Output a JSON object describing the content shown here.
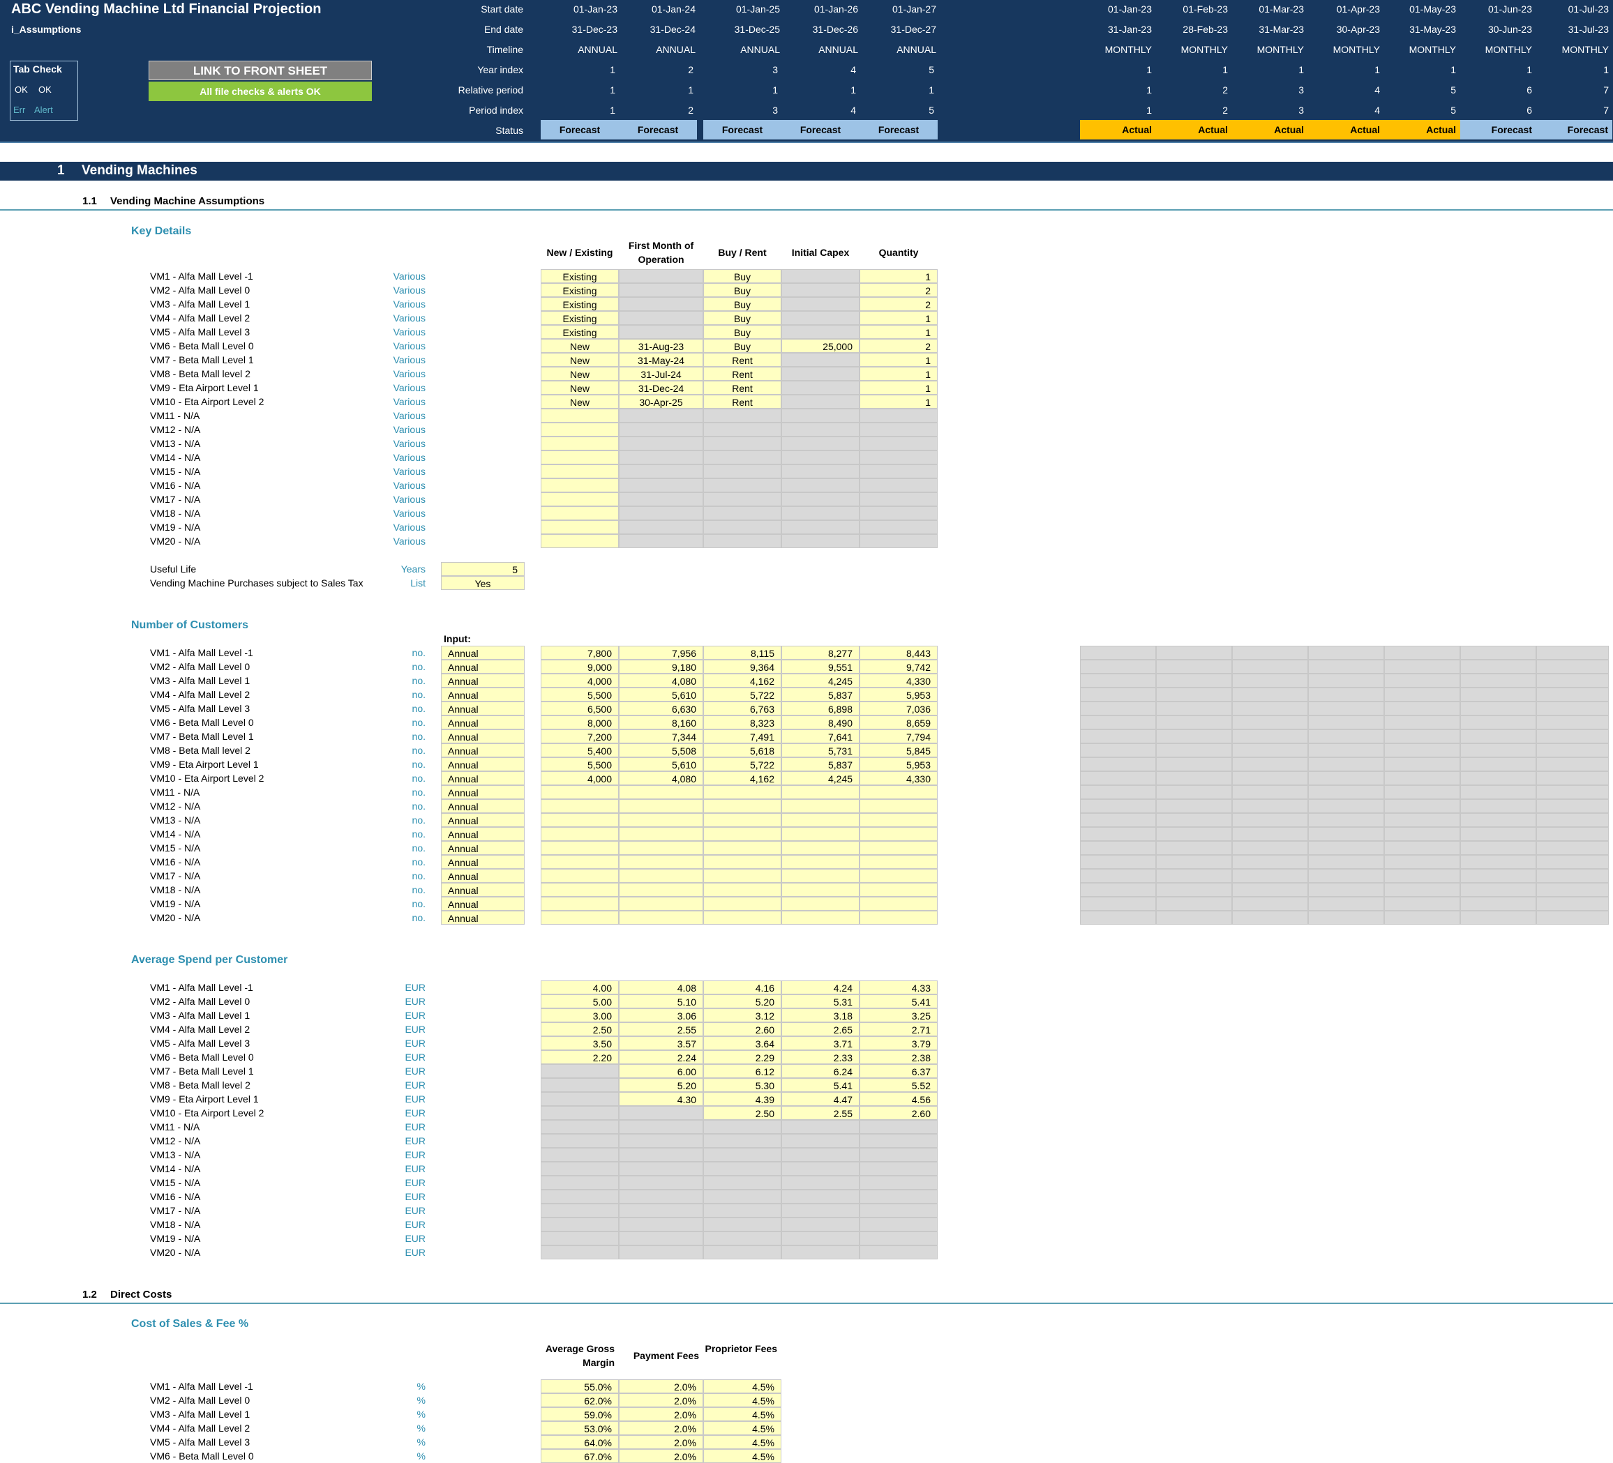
{
  "header": {
    "title": "ABC Vending Machine Ltd Financial Projection",
    "sheet": "i_Assumptions",
    "tabcheck": {
      "label": "Tab Check",
      "ok1": "OK",
      "ok2": "OK",
      "err": "Err",
      "alert": "Alert"
    },
    "link_button": "LINK TO FRONT SHEET",
    "status_button": "All file checks & alerts OK",
    "row_labels": [
      "Start date",
      "End date",
      "Timeline",
      "Year index",
      "Relative period",
      "Period index",
      "Status"
    ],
    "annual": [
      {
        "start": "01-Jan-23",
        "end": "31-Dec-23",
        "timeline": "ANNUAL",
        "year": "1",
        "rel": "1",
        "period": "1",
        "status": "Forecast"
      },
      {
        "start": "01-Jan-24",
        "end": "31-Dec-24",
        "timeline": "ANNUAL",
        "year": "2",
        "rel": "1",
        "period": "2",
        "status": "Forecast"
      },
      {
        "start": "01-Jan-25",
        "end": "31-Dec-25",
        "timeline": "ANNUAL",
        "year": "3",
        "rel": "1",
        "period": "3",
        "status": "Forecast"
      },
      {
        "start": "01-Jan-26",
        "end": "31-Dec-26",
        "timeline": "ANNUAL",
        "year": "4",
        "rel": "1",
        "period": "4",
        "status": "Forecast"
      },
      {
        "start": "01-Jan-27",
        "end": "31-Dec-27",
        "timeline": "ANNUAL",
        "year": "5",
        "rel": "1",
        "period": "5",
        "status": "Forecast"
      }
    ],
    "monthly": [
      {
        "start": "01-Jan-23",
        "end": "31-Jan-23",
        "timeline": "MONTHLY",
        "year": "1",
        "rel": "1",
        "period": "1",
        "status": "Actual"
      },
      {
        "start": "01-Feb-23",
        "end": "28-Feb-23",
        "timeline": "MONTHLY",
        "year": "1",
        "rel": "2",
        "period": "2",
        "status": "Actual"
      },
      {
        "start": "01-Mar-23",
        "end": "31-Mar-23",
        "timeline": "MONTHLY",
        "year": "1",
        "rel": "3",
        "period": "3",
        "status": "Actual"
      },
      {
        "start": "01-Apr-23",
        "end": "30-Apr-23",
        "timeline": "MONTHLY",
        "year": "1",
        "rel": "4",
        "period": "4",
        "status": "Actual"
      },
      {
        "start": "01-May-23",
        "end": "31-May-23",
        "timeline": "MONTHLY",
        "year": "1",
        "rel": "5",
        "period": "5",
        "status": "Actual"
      },
      {
        "start": "01-Jun-23",
        "end": "30-Jun-23",
        "timeline": "MONTHLY",
        "year": "1",
        "rel": "6",
        "period": "6",
        "status": "Forecast"
      },
      {
        "start": "01-Jul-23",
        "end": "31-Jul-23",
        "timeline": "MONTHLY",
        "year": "1",
        "rel": "7",
        "period": "7",
        "status": "Forecast"
      }
    ]
  },
  "colors": {
    "navy": "#17375e",
    "forecast": "#9dc3e6",
    "actual": "#ffc000",
    "input": "#ffffc2",
    "grey": "#d9d9d9",
    "accent": "#2e8fb0",
    "ok_green": "#8dc63f"
  },
  "section1": {
    "num": "1",
    "title": "Vending Machines"
  },
  "s11": {
    "num": "1.1",
    "title": "Vending Machine Assumptions"
  },
  "key_details": {
    "title": "Key Details",
    "headers": [
      "New / Existing",
      "First Month of Operation",
      "Buy / Rent",
      "Initial Capex",
      "Quantity"
    ],
    "rows": [
      {
        "name": "VM1 - Alfa Mall Level -1",
        "unit": "Various",
        "ne": "Existing",
        "fm": "",
        "br": "Buy",
        "capex": "",
        "qty": "1"
      },
      {
        "name": "VM2 - Alfa Mall Level 0",
        "unit": "Various",
        "ne": "Existing",
        "fm": "",
        "br": "Buy",
        "capex": "",
        "qty": "2"
      },
      {
        "name": "VM3 - Alfa Mall Level 1",
        "unit": "Various",
        "ne": "Existing",
        "fm": "",
        "br": "Buy",
        "capex": "",
        "qty": "2"
      },
      {
        "name": "VM4 - Alfa Mall Level 2",
        "unit": "Various",
        "ne": "Existing",
        "fm": "",
        "br": "Buy",
        "capex": "",
        "qty": "1"
      },
      {
        "name": "VM5 - Alfa Mall Level 3",
        "unit": "Various",
        "ne": "Existing",
        "fm": "",
        "br": "Buy",
        "capex": "",
        "qty": "1"
      },
      {
        "name": "VM6 - Beta Mall Level 0",
        "unit": "Various",
        "ne": "New",
        "fm": "31-Aug-23",
        "br": "Buy",
        "capex": "25,000",
        "qty": "2"
      },
      {
        "name": "VM7 - Beta Mall Level 1",
        "unit": "Various",
        "ne": "New",
        "fm": "31-May-24",
        "br": "Rent",
        "capex": "",
        "qty": "1"
      },
      {
        "name": "VM8 - Beta Mall level 2",
        "unit": "Various",
        "ne": "New",
        "fm": "31-Jul-24",
        "br": "Rent",
        "capex": "",
        "qty": "1"
      },
      {
        "name": "VM9 - Eta Airport Level 1",
        "unit": "Various",
        "ne": "New",
        "fm": "31-Dec-24",
        "br": "Rent",
        "capex": "",
        "qty": "1"
      },
      {
        "name": "VM10 - Eta Airport Level 2",
        "unit": "Various",
        "ne": "New",
        "fm": "30-Apr-25",
        "br": "Rent",
        "capex": "",
        "qty": "1"
      },
      {
        "name": "VM11 - N/A",
        "unit": "Various",
        "ne": "",
        "fm": "",
        "br": "",
        "capex": "",
        "qty": ""
      },
      {
        "name": "VM12 - N/A",
        "unit": "Various",
        "ne": "",
        "fm": "",
        "br": "",
        "capex": "",
        "qty": ""
      },
      {
        "name": "VM13 - N/A",
        "unit": "Various",
        "ne": "",
        "fm": "",
        "br": "",
        "capex": "",
        "qty": ""
      },
      {
        "name": "VM14 - N/A",
        "unit": "Various",
        "ne": "",
        "fm": "",
        "br": "",
        "capex": "",
        "qty": ""
      },
      {
        "name": "VM15 - N/A",
        "unit": "Various",
        "ne": "",
        "fm": "",
        "br": "",
        "capex": "",
        "qty": ""
      },
      {
        "name": "VM16 - N/A",
        "unit": "Various",
        "ne": "",
        "fm": "",
        "br": "",
        "capex": "",
        "qty": ""
      },
      {
        "name": "VM17 - N/A",
        "unit": "Various",
        "ne": "",
        "fm": "",
        "br": "",
        "capex": "",
        "qty": ""
      },
      {
        "name": "VM18 - N/A",
        "unit": "Various",
        "ne": "",
        "fm": "",
        "br": "",
        "capex": "",
        "qty": ""
      },
      {
        "name": "VM19 - N/A",
        "unit": "Various",
        "ne": "",
        "fm": "",
        "br": "",
        "capex": "",
        "qty": ""
      },
      {
        "name": "VM20 - N/A",
        "unit": "Various",
        "ne": "",
        "fm": "",
        "br": "",
        "capex": "",
        "qty": ""
      }
    ],
    "useful_life": {
      "label": "Useful Life",
      "unit": "Years",
      "value": "5"
    },
    "sales_tax": {
      "label": "Vending Machine Purchases subject to Sales Tax",
      "unit": "List",
      "value": "Yes"
    }
  },
  "customers": {
    "title": "Number of Customers",
    "input_label": "Input:",
    "rows": [
      {
        "name": "VM1 - Alfa Mall Level -1",
        "unit": "no.",
        "input": "Annual",
        "v": [
          "7,800",
          "7,956",
          "8,115",
          "8,277",
          "8,443"
        ]
      },
      {
        "name": "VM2 - Alfa Mall Level 0",
        "unit": "no.",
        "input": "Annual",
        "v": [
          "9,000",
          "9,180",
          "9,364",
          "9,551",
          "9,742"
        ]
      },
      {
        "name": "VM3 - Alfa Mall Level 1",
        "unit": "no.",
        "input": "Annual",
        "v": [
          "4,000",
          "4,080",
          "4,162",
          "4,245",
          "4,330"
        ]
      },
      {
        "name": "VM4 - Alfa Mall Level 2",
        "unit": "no.",
        "input": "Annual",
        "v": [
          "5,500",
          "5,610",
          "5,722",
          "5,837",
          "5,953"
        ]
      },
      {
        "name": "VM5 - Alfa Mall Level 3",
        "unit": "no.",
        "input": "Annual",
        "v": [
          "6,500",
          "6,630",
          "6,763",
          "6,898",
          "7,036"
        ]
      },
      {
        "name": "VM6 - Beta Mall Level 0",
        "unit": "no.",
        "input": "Annual",
        "v": [
          "8,000",
          "8,160",
          "8,323",
          "8,490",
          "8,659"
        ]
      },
      {
        "name": "VM7 - Beta Mall Level 1",
        "unit": "no.",
        "input": "Annual",
        "v": [
          "7,200",
          "7,344",
          "7,491",
          "7,641",
          "7,794"
        ]
      },
      {
        "name": "VM8 - Beta Mall level 2",
        "unit": "no.",
        "input": "Annual",
        "v": [
          "5,400",
          "5,508",
          "5,618",
          "5,731",
          "5,845"
        ]
      },
      {
        "name": "VM9 - Eta Airport Level 1",
        "unit": "no.",
        "input": "Annual",
        "v": [
          "5,500",
          "5,610",
          "5,722",
          "5,837",
          "5,953"
        ]
      },
      {
        "name": "VM10 - Eta Airport Level 2",
        "unit": "no.",
        "input": "Annual",
        "v": [
          "4,000",
          "4,080",
          "4,162",
          "4,245",
          "4,330"
        ]
      },
      {
        "name": "VM11 - N/A",
        "unit": "no.",
        "input": "Annual",
        "v": [
          "",
          "",
          "",
          "",
          ""
        ]
      },
      {
        "name": "VM12 - N/A",
        "unit": "no.",
        "input": "Annual",
        "v": [
          "",
          "",
          "",
          "",
          ""
        ]
      },
      {
        "name": "VM13 - N/A",
        "unit": "no.",
        "input": "Annual",
        "v": [
          "",
          "",
          "",
          "",
          ""
        ]
      },
      {
        "name": "VM14 - N/A",
        "unit": "no.",
        "input": "Annual",
        "v": [
          "",
          "",
          "",
          "",
          ""
        ]
      },
      {
        "name": "VM15 - N/A",
        "unit": "no.",
        "input": "Annual",
        "v": [
          "",
          "",
          "",
          "",
          ""
        ]
      },
      {
        "name": "VM16 - N/A",
        "unit": "no.",
        "input": "Annual",
        "v": [
          "",
          "",
          "",
          "",
          ""
        ]
      },
      {
        "name": "VM17 - N/A",
        "unit": "no.",
        "input": "Annual",
        "v": [
          "",
          "",
          "",
          "",
          ""
        ]
      },
      {
        "name": "VM18 - N/A",
        "unit": "no.",
        "input": "Annual",
        "v": [
          "",
          "",
          "",
          "",
          ""
        ]
      },
      {
        "name": "VM19 - N/A",
        "unit": "no.",
        "input": "Annual",
        "v": [
          "",
          "",
          "",
          "",
          ""
        ]
      },
      {
        "name": "VM20 - N/A",
        "unit": "no.",
        "input": "Annual",
        "v": [
          "",
          "",
          "",
          "",
          ""
        ]
      }
    ]
  },
  "spend": {
    "title": "Average Spend per Customer",
    "rows": [
      {
        "name": "VM1 - Alfa Mall Level -1",
        "unit": "EUR",
        "v": [
          "4.00",
          "4.08",
          "4.16",
          "4.24",
          "4.33"
        ]
      },
      {
        "name": "VM2 - Alfa Mall Level 0",
        "unit": "EUR",
        "v": [
          "5.00",
          "5.10",
          "5.20",
          "5.31",
          "5.41"
        ]
      },
      {
        "name": "VM3 - Alfa Mall Level 1",
        "unit": "EUR",
        "v": [
          "3.00",
          "3.06",
          "3.12",
          "3.18",
          "3.25"
        ]
      },
      {
        "name": "VM4 - Alfa Mall Level 2",
        "unit": "EUR",
        "v": [
          "2.50",
          "2.55",
          "2.60",
          "2.65",
          "2.71"
        ]
      },
      {
        "name": "VM5 - Alfa Mall Level 3",
        "unit": "EUR",
        "v": [
          "3.50",
          "3.57",
          "3.64",
          "3.71",
          "3.79"
        ]
      },
      {
        "name": "VM6 - Beta Mall Level 0",
        "unit": "EUR",
        "v": [
          "2.20",
          "2.24",
          "2.29",
          "2.33",
          "2.38"
        ]
      },
      {
        "name": "VM7 - Beta Mall Level 1",
        "unit": "EUR",
        "v": [
          "",
          "6.00",
          "6.12",
          "6.24",
          "6.37"
        ]
      },
      {
        "name": "VM8 - Beta Mall level 2",
        "unit": "EUR",
        "v": [
          "",
          "5.20",
          "5.30",
          "5.41",
          "5.52"
        ]
      },
      {
        "name": "VM9 - Eta Airport Level 1",
        "unit": "EUR",
        "v": [
          "",
          "4.30",
          "4.39",
          "4.47",
          "4.56"
        ]
      },
      {
        "name": "VM10 - Eta Airport Level 2",
        "unit": "EUR",
        "v": [
          "",
          "",
          "2.50",
          "2.55",
          "2.60"
        ]
      },
      {
        "name": "VM11 - N/A",
        "unit": "EUR",
        "v": [
          "",
          "",
          "",
          "",
          ""
        ]
      },
      {
        "name": "VM12 - N/A",
        "unit": "EUR",
        "v": [
          "",
          "",
          "",
          "",
          ""
        ]
      },
      {
        "name": "VM13 - N/A",
        "unit": "EUR",
        "v": [
          "",
          "",
          "",
          "",
          ""
        ]
      },
      {
        "name": "VM14 - N/A",
        "unit": "EUR",
        "v": [
          "",
          "",
          "",
          "",
          ""
        ]
      },
      {
        "name": "VM15 - N/A",
        "unit": "EUR",
        "v": [
          "",
          "",
          "",
          "",
          ""
        ]
      },
      {
        "name": "VM16 - N/A",
        "unit": "EUR",
        "v": [
          "",
          "",
          "",
          "",
          ""
        ]
      },
      {
        "name": "VM17 - N/A",
        "unit": "EUR",
        "v": [
          "",
          "",
          "",
          "",
          ""
        ]
      },
      {
        "name": "VM18 - N/A",
        "unit": "EUR",
        "v": [
          "",
          "",
          "",
          "",
          ""
        ]
      },
      {
        "name": "VM19 - N/A",
        "unit": "EUR",
        "v": [
          "",
          "",
          "",
          "",
          ""
        ]
      },
      {
        "name": "VM20 - N/A",
        "unit": "EUR",
        "v": [
          "",
          "",
          "",
          "",
          ""
        ]
      }
    ]
  },
  "s12": {
    "num": "1.2",
    "title": "Direct Costs"
  },
  "cost_of_sales": {
    "title": "Cost of Sales & Fee %",
    "headers": [
      "Average Gross Margin",
      "Payment Fees",
      "Proprietor Fees"
    ],
    "rows": [
      {
        "name": "VM1 - Alfa Mall Level -1",
        "unit": "%",
        "v": [
          "55.0%",
          "2.0%",
          "4.5%"
        ]
      },
      {
        "name": "VM2 - Alfa Mall Level 0",
        "unit": "%",
        "v": [
          "62.0%",
          "2.0%",
          "4.5%"
        ]
      },
      {
        "name": "VM3 - Alfa Mall Level 1",
        "unit": "%",
        "v": [
          "59.0%",
          "2.0%",
          "4.5%"
        ]
      },
      {
        "name": "VM4 - Alfa Mall Level 2",
        "unit": "%",
        "v": [
          "53.0%",
          "2.0%",
          "4.5%"
        ]
      },
      {
        "name": "VM5 - Alfa Mall Level 3",
        "unit": "%",
        "v": [
          "64.0%",
          "2.0%",
          "4.5%"
        ]
      },
      {
        "name": "VM6 - Beta Mall Level 0",
        "unit": "%",
        "v": [
          "67.0%",
          "2.0%",
          "4.5%"
        ]
      }
    ]
  }
}
